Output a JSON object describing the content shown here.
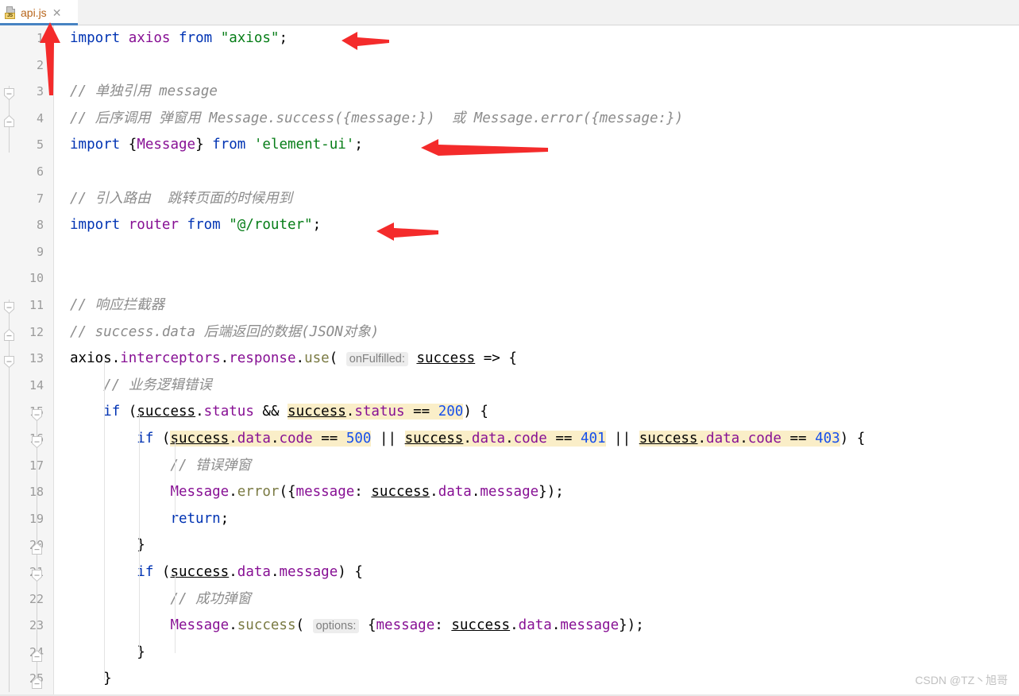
{
  "editor": {
    "tab": {
      "label": "api.js",
      "icon": "js-file-icon",
      "icon_text": "JS",
      "close_glyph": "✕",
      "modified_color": "#b8651a",
      "underline_color": "#4783c2"
    },
    "colors": {
      "gutter_bg": "#f5f5f5",
      "editor_bg": "#ffffff",
      "line_number": "#9b9b9b",
      "keyword": "#0033b3",
      "string": "#067d17",
      "number": "#1750eb",
      "property": "#871094",
      "function": "#7a7a43",
      "comment": "#8c8c8c",
      "search_highlight": "#faeec8",
      "inlay_hint_bg": "#ededed",
      "inlay_hint_fg": "#808080",
      "annotation_arrow": "#f42b2b"
    },
    "lines": [
      {
        "n": "1",
        "text": "import axios from \"axios\";"
      },
      {
        "n": "2",
        "text": ""
      },
      {
        "n": "3",
        "text": "// 单独引用 message"
      },
      {
        "n": "4",
        "text": "// 后序调用 弹窗用 Message.success({message:})  或 Message.error({message:})"
      },
      {
        "n": "5",
        "text": "import {Message} from 'element-ui';"
      },
      {
        "n": "6",
        "text": ""
      },
      {
        "n": "7",
        "text": "// 引入路由  跳转页面的时候用到"
      },
      {
        "n": "8",
        "text": "import router from \"@/router\";"
      },
      {
        "n": "9",
        "text": ""
      },
      {
        "n": "10",
        "text": ""
      },
      {
        "n": "11",
        "text": "// 响应拦截器"
      },
      {
        "n": "12",
        "text": "// success.data 后端返回的数据(JSON对象)"
      },
      {
        "n": "13",
        "text": "axios.interceptors.response.use( onFulfilled: success => {"
      },
      {
        "n": "14",
        "text": "    // 业务逻辑错误"
      },
      {
        "n": "15",
        "text": "    if (success.status && success.status == 200) {"
      },
      {
        "n": "16",
        "text": "        if (success.data.code == 500 || success.data.code == 401 || success.data.code == 403) {"
      },
      {
        "n": "17",
        "text": "            // 错误弹窗"
      },
      {
        "n": "18",
        "text": "            Message.error({message: success.data.message});"
      },
      {
        "n": "19",
        "text": "            return;"
      },
      {
        "n": "20",
        "text": "        }"
      },
      {
        "n": "21",
        "text": "        if (success.data.message) {"
      },
      {
        "n": "22",
        "text": "            // 成功弹窗"
      },
      {
        "n": "23",
        "text": "            Message.success( options: {message: success.data.message});"
      },
      {
        "n": "24",
        "text": "        }"
      },
      {
        "n": "25",
        "text": "    }"
      }
    ],
    "inlay_hints": [
      {
        "line": "13",
        "label": "onFulfilled:"
      },
      {
        "line": "23",
        "label": "options:"
      }
    ],
    "annotations": [
      {
        "name": "arrow-pointing-at-tab",
        "direction": "up"
      },
      {
        "name": "arrow-line-1",
        "direction": "left"
      },
      {
        "name": "arrow-line-5",
        "direction": "left"
      },
      {
        "name": "arrow-line-8",
        "direction": "left"
      }
    ]
  },
  "watermark": {
    "text": "CSDN @TZ丶旭哥"
  }
}
